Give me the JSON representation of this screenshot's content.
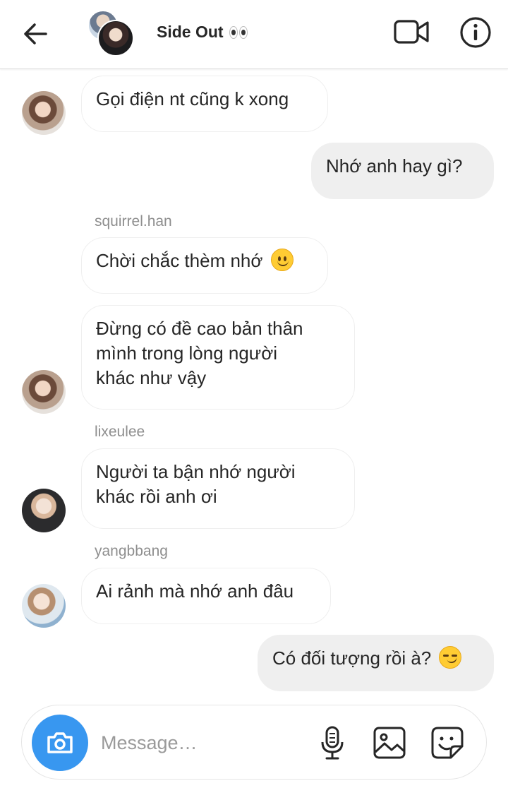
{
  "header": {
    "title": "Side Out",
    "back_icon": "arrow-left-icon",
    "video_icon": "video-camera-icon",
    "info_icon": "info-icon"
  },
  "messages": [
    {
      "direction": "in",
      "sender": "",
      "text": "Gọi điện nt cũng k xong"
    },
    {
      "direction": "out",
      "text": "Nhớ anh hay gì?"
    },
    {
      "direction": "in",
      "sender": "squirrel.han",
      "text": "Chời chắc thèm nhớ",
      "emoji": "slightly-smiling-face"
    },
    {
      "direction": "in",
      "sender": "",
      "lines": [
        "Đừng có đề cao bản thân",
        "mình trong lòng người",
        "khác như vậy"
      ]
    },
    {
      "direction": "in",
      "sender": "lixeulee",
      "lines": [
        "Người ta bận nhớ người",
        "khác rồi anh ơi"
      ]
    },
    {
      "direction": "in",
      "sender": "yangbbang",
      "text": "Ai rảnh mà nhớ anh đâu"
    },
    {
      "direction": "out",
      "text": "Có đối tượng rồi à?",
      "emoji": "smirking-face"
    }
  ],
  "composer": {
    "placeholder": "Message…",
    "camera_icon": "camera-icon",
    "mic_icon": "microphone-icon",
    "gallery_icon": "image-icon",
    "sticker_icon": "sticker-icon"
  },
  "colors": {
    "accent": "#3897f0",
    "outgoing_bubble": "#efefef",
    "incoming_border": "#efefef",
    "sender_text": "#8e8e8e"
  }
}
